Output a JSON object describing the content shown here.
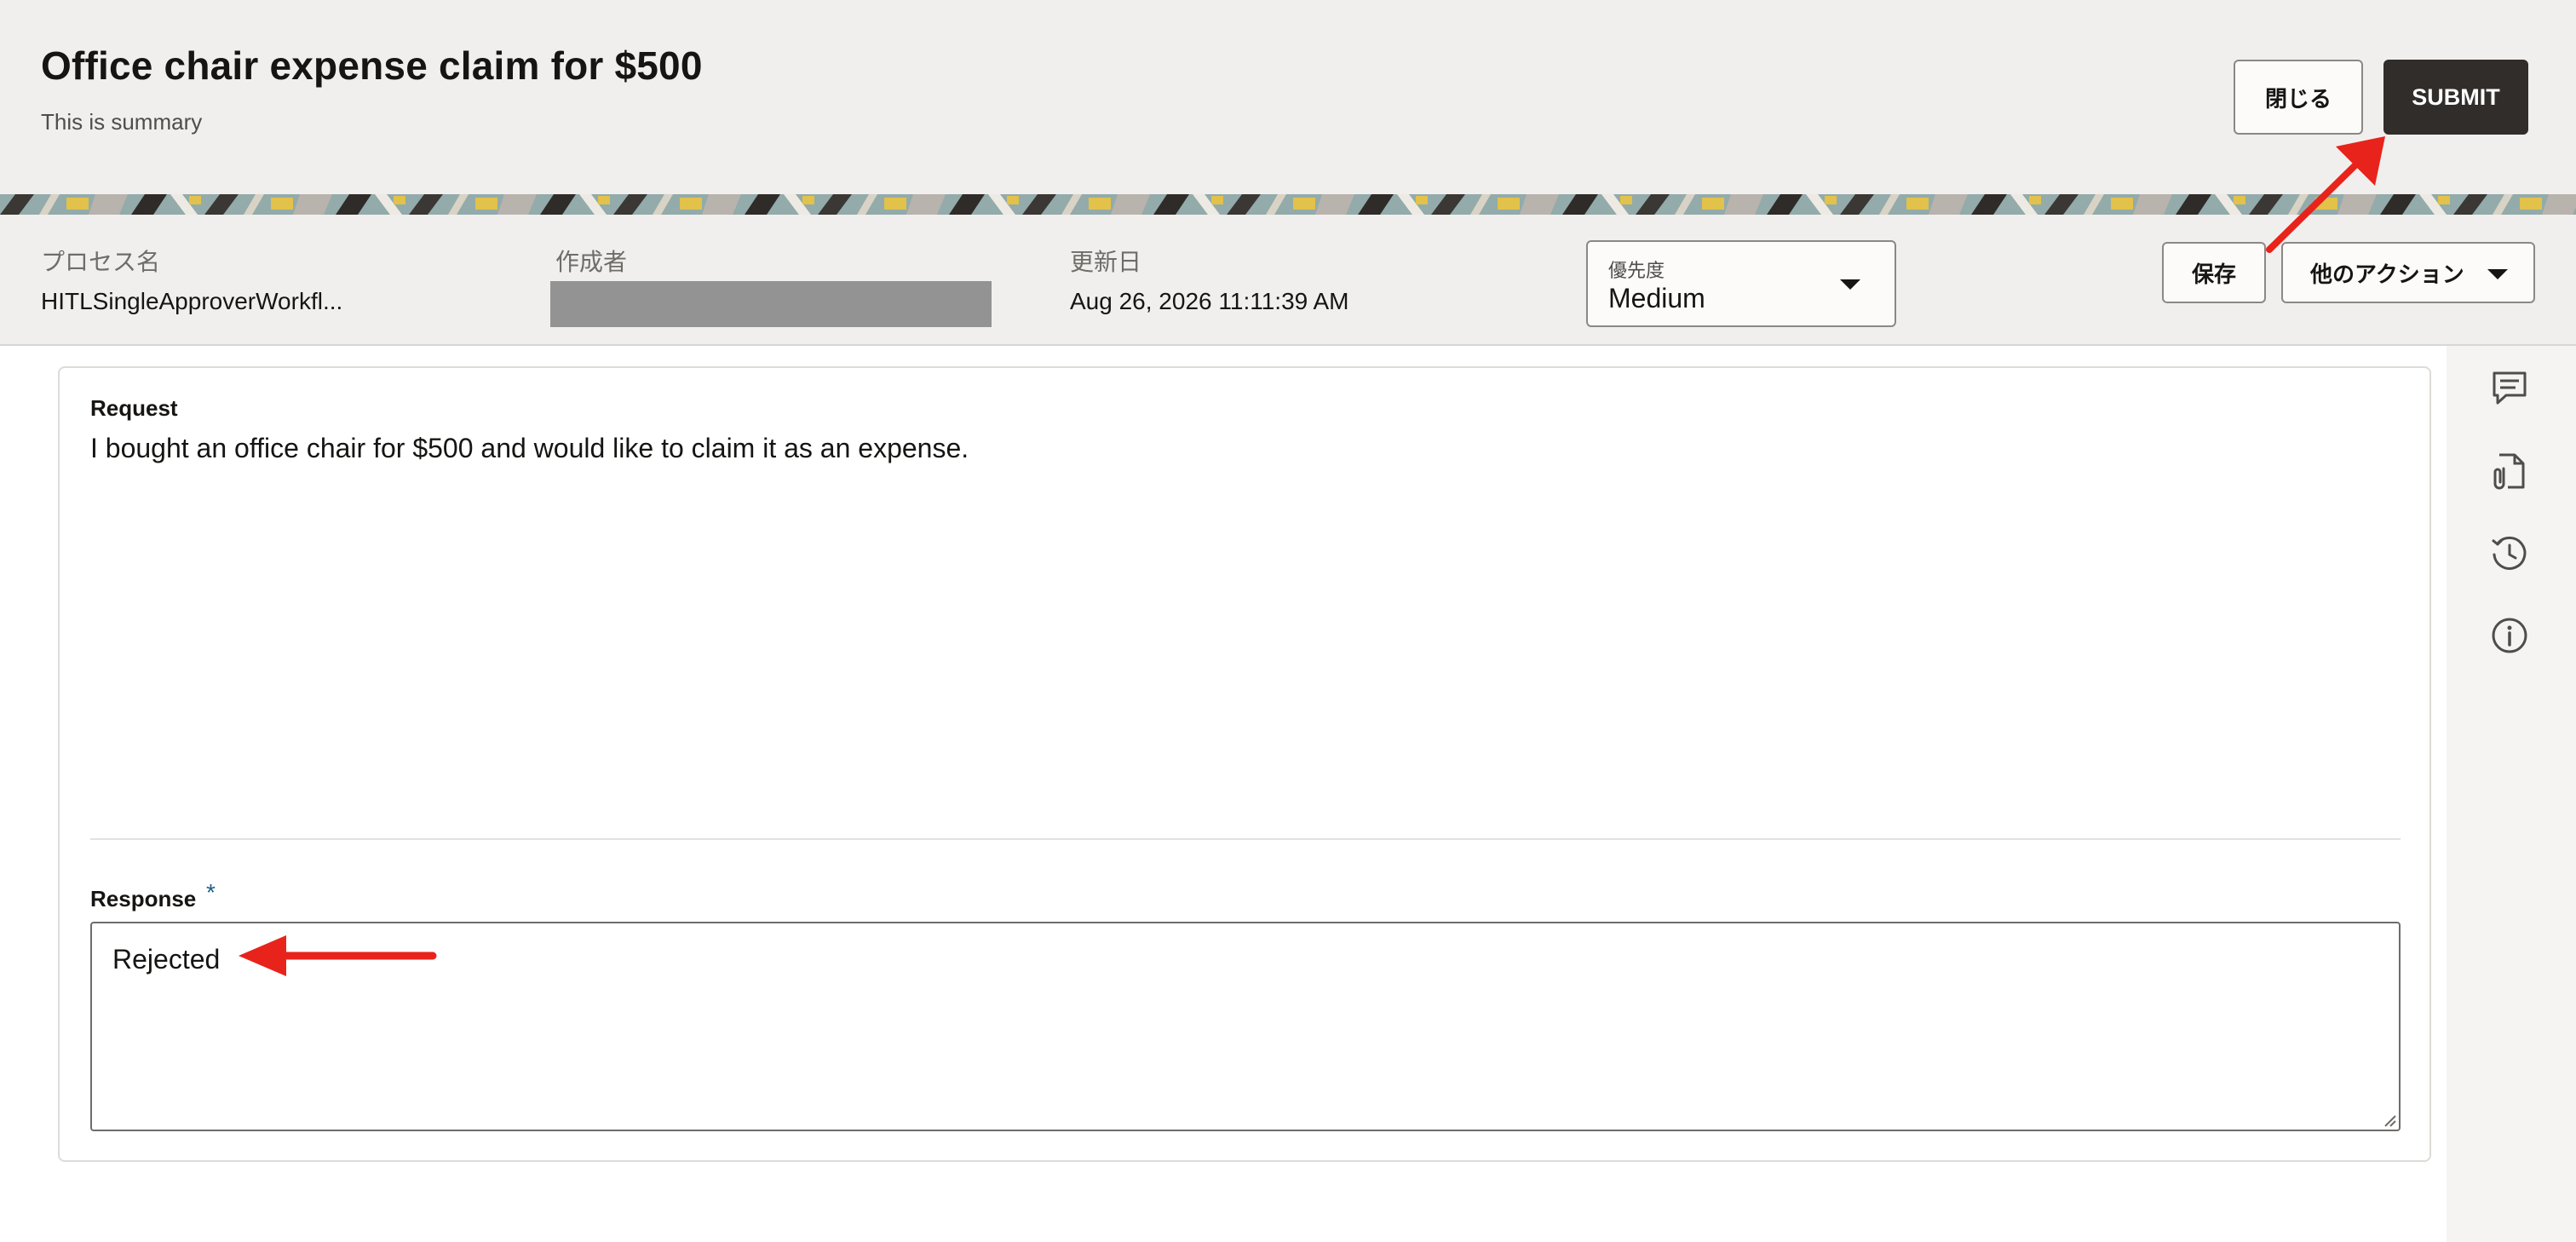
{
  "header": {
    "title": "Office chair expense claim for $500",
    "summary": "This is summary",
    "close_label": "閉じる",
    "submit_label": "SUBMIT"
  },
  "info": {
    "process_label": "プロセス名",
    "process_value": "HITLSingleApproverWorkfl...",
    "creator_label": "作成者",
    "updated_label": "更新日",
    "updated_value": "Aug 26, 2026 11:11:39 AM",
    "priority_label": "優先度",
    "priority_value": "Medium",
    "save_label": "保存",
    "more_actions_label": "他のアクション"
  },
  "form": {
    "request_label": "Request",
    "request_text": "I bought an office chair for $500 and would like to claim it as an expense.",
    "response_label": "Response",
    "required_marker": "*",
    "response_value": "Rejected"
  },
  "sidebar": {
    "icons": [
      "comment-icon",
      "attachment-icon",
      "history-icon",
      "info-icon"
    ]
  },
  "colors": {
    "header_bg": "#f1efed",
    "submit_bg": "#312d2a",
    "annotation_arrow": "#e8231b",
    "required_star": "#1f5e8c"
  }
}
